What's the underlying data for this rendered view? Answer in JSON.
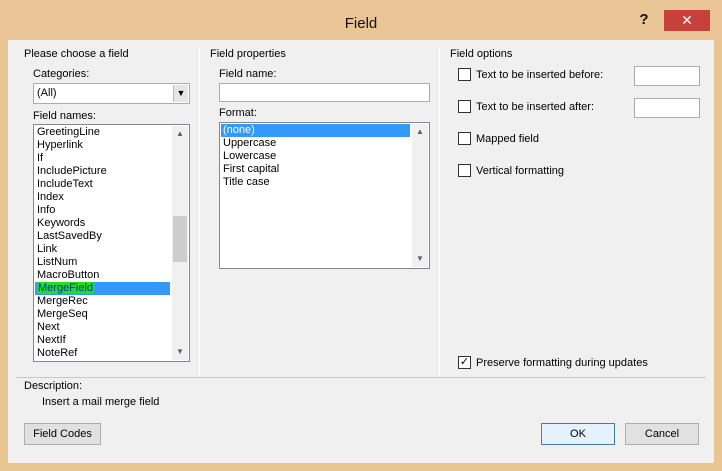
{
  "window": {
    "title": "Field",
    "help": "?",
    "close": "✕"
  },
  "choose": {
    "header": "Please choose a field",
    "categories_label": "Categories:",
    "categories_value": "(All)",
    "field_names_label": "Field names:",
    "field_names": [
      "GreetingLine",
      "Hyperlink",
      "If",
      "IncludePicture",
      "IncludeText",
      "Index",
      "Info",
      "Keywords",
      "LastSavedBy",
      "Link",
      "ListNum",
      "MacroButton",
      "MergeField",
      "MergeRec",
      "MergeSeq",
      "Next",
      "NextIf",
      "NoteRef"
    ],
    "selected_field": "MergeField"
  },
  "properties": {
    "header": "Field properties",
    "field_name_label": "Field name:",
    "field_name_value": "",
    "format_label": "Format:",
    "formats": [
      "(none)",
      "Uppercase",
      "Lowercase",
      "First capital",
      "Title case"
    ],
    "selected_format": "(none)"
  },
  "options": {
    "header": "Field options",
    "before_label": "Text to be inserted before:",
    "before_value": "",
    "after_label": "Text to be inserted after:",
    "after_value": "",
    "mapped_label": "Mapped field",
    "mapped_checked": false,
    "vertical_label": "Vertical formatting",
    "vertical_checked": false,
    "preserve_label": "Preserve formatting during updates",
    "preserve_checked": true
  },
  "description": {
    "label": "Description:",
    "text": "Insert a mail merge field"
  },
  "buttons": {
    "field_codes": "Field Codes",
    "ok": "OK",
    "cancel": "Cancel"
  },
  "colors": {
    "titlebar": "#eac595",
    "close": "#c7403a",
    "selection": "#3399ff",
    "highlight": "#22dd22"
  }
}
